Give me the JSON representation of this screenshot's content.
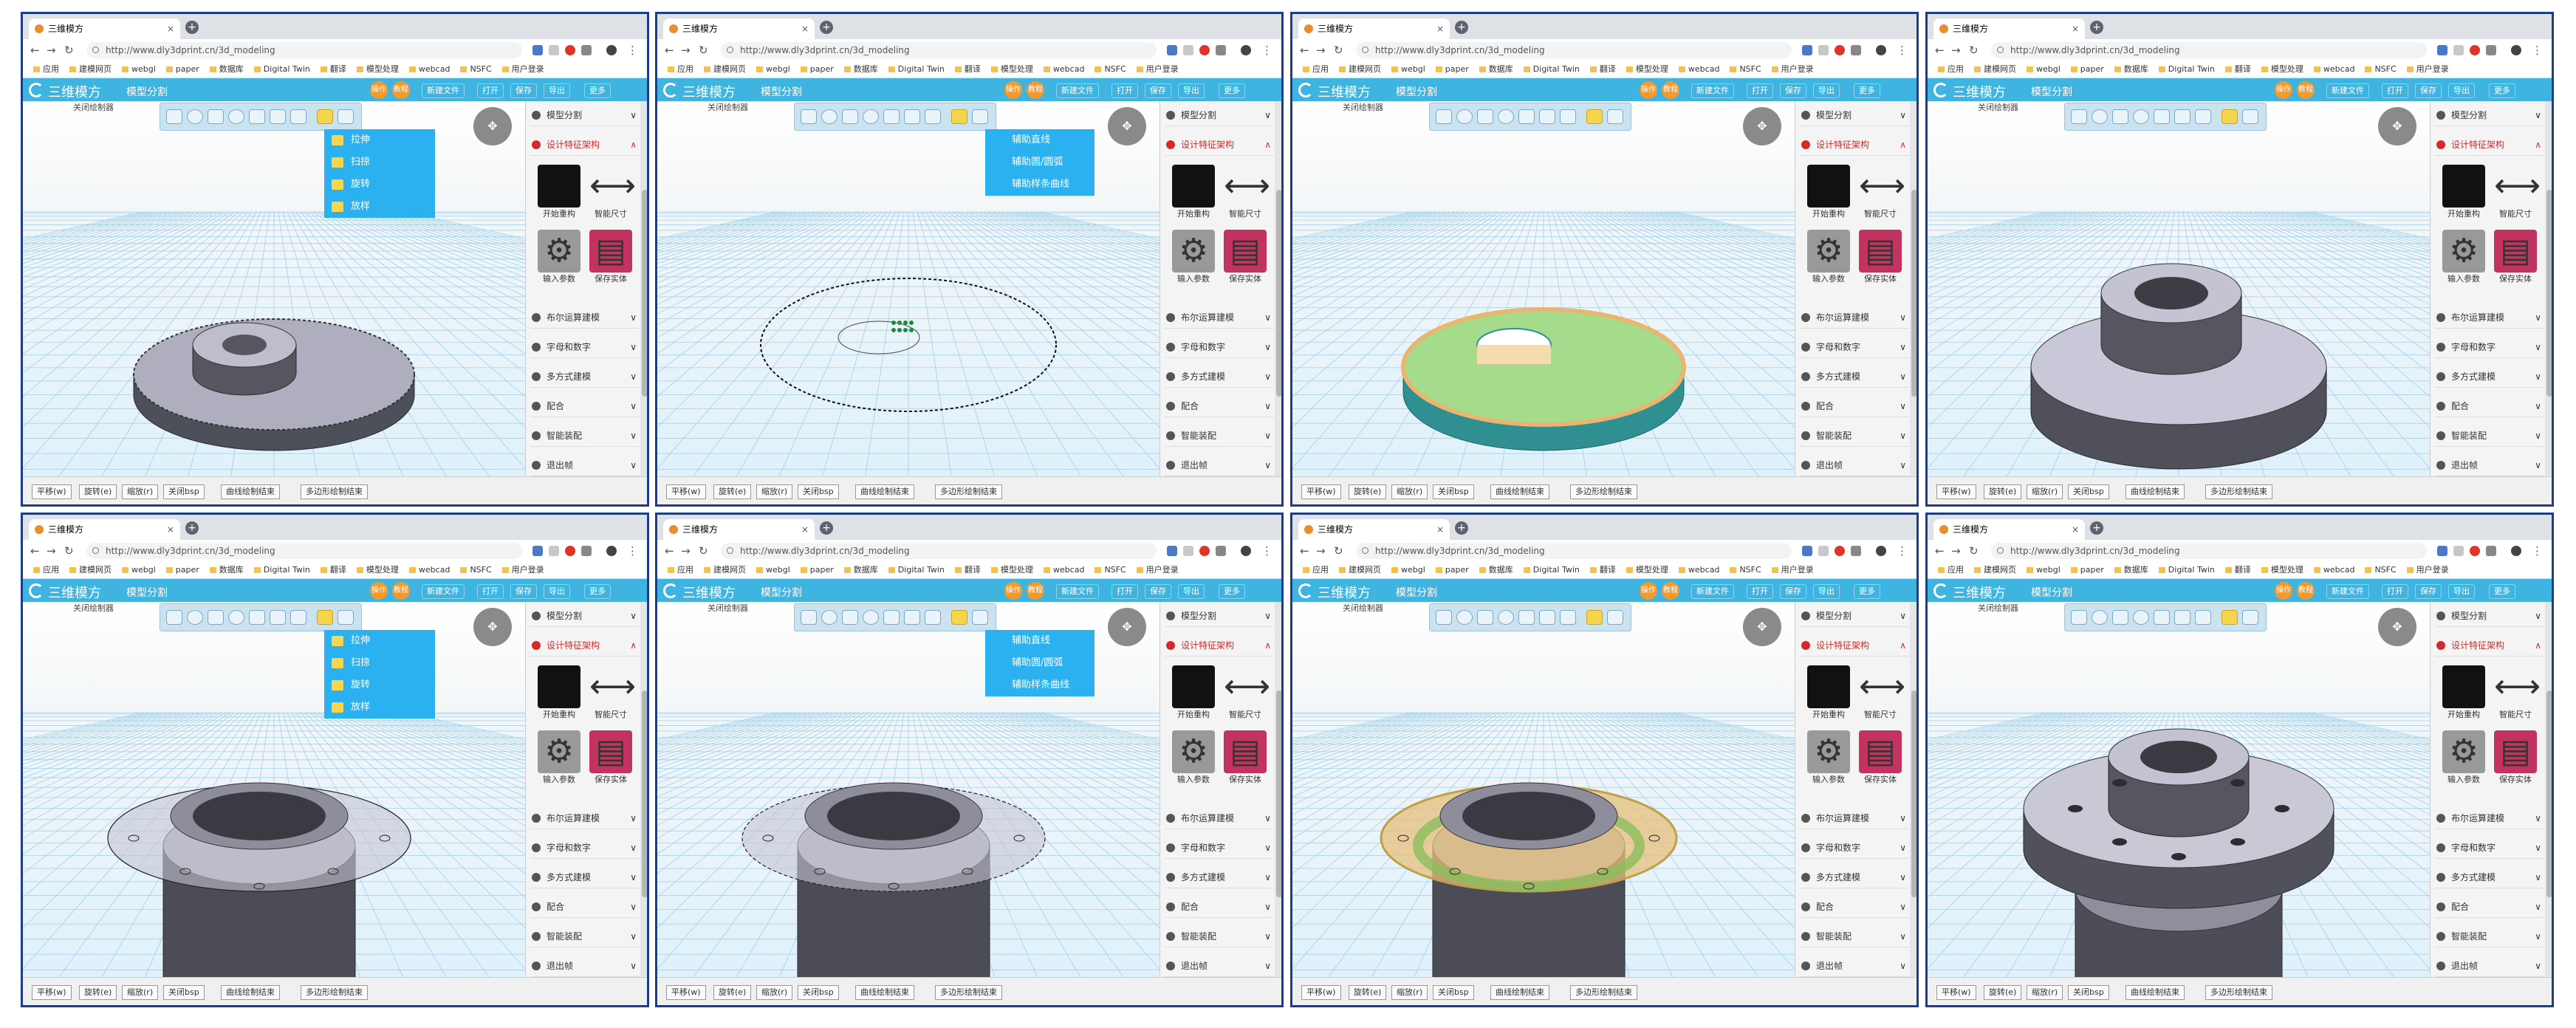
{
  "tab_title": "三维模方",
  "url": "http://www.dly3dprint.cn/3d_modeling",
  "bookmarks": [
    "应用",
    "建模网页",
    "webgl",
    "paper",
    "数据库",
    "Digital Twin",
    "翻译",
    "模型处理",
    "webcad",
    "NSFC",
    "用户登录"
  ],
  "app": {
    "name": "三维模方",
    "subtitle": "模型分割",
    "header_buttons": [
      "新建文件",
      "打开",
      "保存",
      "导出",
      "更多"
    ],
    "round_labels": [
      "操作",
      "教程"
    ]
  },
  "close_draw_label": "关闭绘制器",
  "bottom_buttons": [
    "平移(w)",
    "旋转(e)",
    "缩放(r)",
    "关闭bsp",
    "曲线绘制结束",
    "多边形绘制结束"
  ],
  "side_panel": {
    "items_top": [
      "模型分割",
      "设计特征架构"
    ],
    "big_icons": [
      "开始重构",
      "智能尺寸",
      "输入参数",
      "保存实体"
    ],
    "items_bottom": [
      "布尔运算建模",
      "字母和数字",
      "多方式建模",
      "配合",
      "智能装配",
      "退出帧"
    ]
  },
  "dropdown_sweep": [
    "拉伸",
    "扫掠",
    "旋转",
    "放样"
  ],
  "dropdown_aux": [
    "辅助直线",
    "辅助圆/圆弧",
    "辅助样条曲线"
  ],
  "panes": [
    {
      "id": "p1",
      "dropdown": "sweep",
      "scene": "disc-sketch"
    },
    {
      "id": "p2",
      "dropdown": "aux",
      "scene": "outline"
    },
    {
      "id": "p3",
      "dropdown": "none",
      "scene": "disc-colored"
    },
    {
      "id": "p4",
      "dropdown": "none",
      "scene": "disc-solid"
    },
    {
      "id": "p5",
      "dropdown": "sweep",
      "scene": "cyl-sketch"
    },
    {
      "id": "p6",
      "dropdown": "aux",
      "scene": "cyl-outline"
    },
    {
      "id": "p7",
      "dropdown": "none",
      "scene": "cyl-colored"
    },
    {
      "id": "p8",
      "dropdown": "none",
      "scene": "cyl-solid"
    }
  ]
}
